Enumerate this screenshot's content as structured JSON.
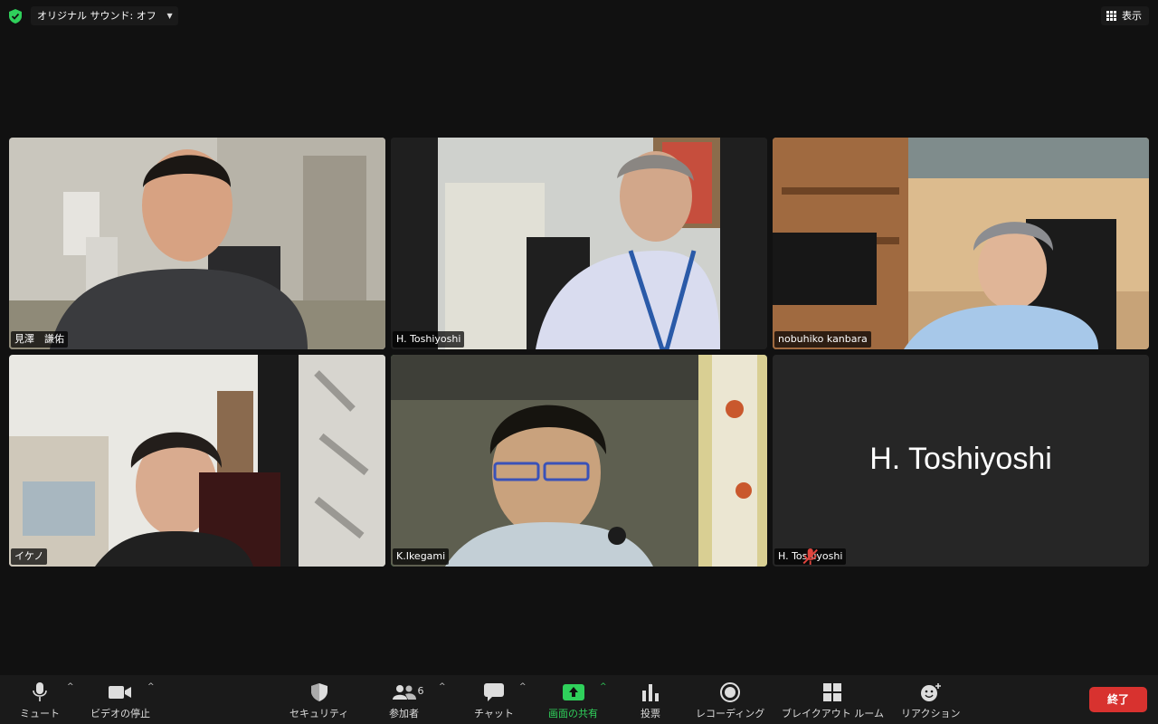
{
  "top": {
    "audio_label": "オリジナル サウンド: オフ",
    "view_label": "表示"
  },
  "tiles": [
    {
      "name": "見澤　謙佑"
    },
    {
      "name": "H. Toshiyoshi"
    },
    {
      "name": "nobuhiko kanbara"
    },
    {
      "name": "イケノ"
    },
    {
      "name": "K.Ikegami"
    },
    {
      "name": "H. Toshiyoshi",
      "display_name": "H. Toshiyoshi",
      "muted": true
    }
  ],
  "toolbar": {
    "mute": "ミュート",
    "video_stop": "ビデオの停止",
    "security": "セキュリティ",
    "participants": "参加者",
    "participants_count": "6",
    "chat": "チャット",
    "share": "画面の共有",
    "poll": "投票",
    "record": "レコーディング",
    "breakout": "ブレイクアウト ルーム",
    "reaction": "リアクション",
    "end": "終了"
  },
  "colors": {
    "active_border": "#2fd05b",
    "end_button": "#d8322f",
    "background": "#111111"
  }
}
